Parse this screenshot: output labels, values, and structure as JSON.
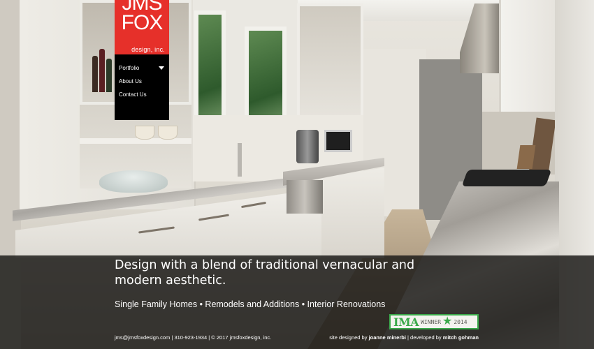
{
  "brand": {
    "logo_line1": "JMS",
    "logo_line2": "FOX",
    "logo_sub": "design, inc.",
    "logo_color": "#e6302a"
  },
  "nav": {
    "items": [
      {
        "label": "Portfolio",
        "has_dropdown": true
      },
      {
        "label": "About Us",
        "has_dropdown": false
      },
      {
        "label": "Contact Us",
        "has_dropdown": false
      }
    ]
  },
  "hero": {
    "tagline": "Design with a blend of traditional vernacular and modern aesthetic.",
    "services": "Single Family Homes • Remodels and Additions • Interior Renovations"
  },
  "badge": {
    "ima": "IMA",
    "winner": "WINNER",
    "star_icon": "star-icon",
    "year": "2014",
    "color": "#3aa94a"
  },
  "footer": {
    "email": "jms@jmsfoxdesign.com",
    "sep1": " | ",
    "phone": "310-923-1934",
    "sep2": " | ",
    "copyright": "© 2017 jmsfoxdesign, inc.",
    "designed_prefix": "site designed by ",
    "designer": "joanne minerbi",
    "dev_sep": " | developed by ",
    "developer": "mitch gohman"
  }
}
